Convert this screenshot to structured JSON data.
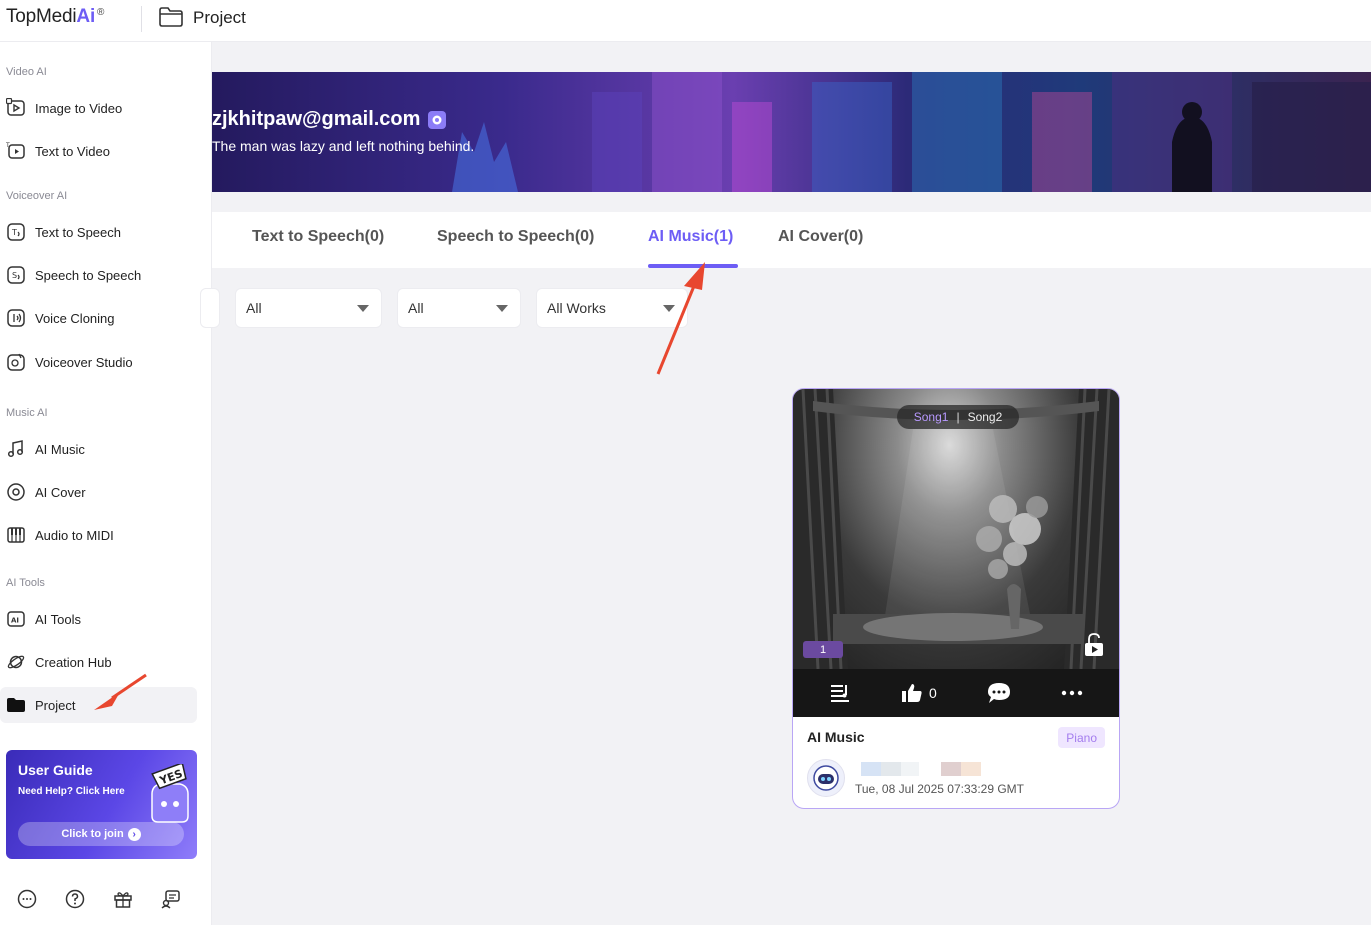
{
  "app": {
    "logo_text": "TopMedi",
    "logo_ai": "Ai",
    "logo_reg": "®",
    "page_title": "Project"
  },
  "sidebar": {
    "sections": [
      {
        "title": "Video AI",
        "items": [
          {
            "label": "Image to Video",
            "icon": "image-to-video-icon"
          },
          {
            "label": "Text to Video",
            "icon": "text-to-video-icon"
          }
        ]
      },
      {
        "title": "Voiceover AI",
        "items": [
          {
            "label": "Text to Speech",
            "icon": "text-to-speech-icon"
          },
          {
            "label": "Speech to Speech",
            "icon": "speech-to-speech-icon"
          },
          {
            "label": "Voice Cloning",
            "icon": "voice-cloning-icon"
          },
          {
            "label": "Voiceover Studio",
            "icon": "voiceover-studio-icon"
          }
        ]
      },
      {
        "title": "Music AI",
        "items": [
          {
            "label": "AI Music",
            "icon": "music-note-icon"
          },
          {
            "label": "AI Cover",
            "icon": "disc-icon"
          },
          {
            "label": "Audio to MIDI",
            "icon": "piano-icon"
          }
        ]
      },
      {
        "title": "AI Tools",
        "items": [
          {
            "label": "AI Tools",
            "icon": "ai-tools-icon"
          },
          {
            "label": "Creation Hub",
            "icon": "planet-icon"
          },
          {
            "label": "Project",
            "icon": "folder-icon",
            "active": true
          }
        ]
      }
    ],
    "guide": {
      "title": "User Guide",
      "subtitle": "Need Help? Click Here",
      "button": "Click to join",
      "mascot_text": "YES"
    },
    "bottom_icons": [
      "chat-icon",
      "help-icon",
      "gift-icon",
      "feedback-icon"
    ]
  },
  "profile": {
    "email": "zjkhitpaw@gmail.com",
    "bio": "The man was lazy and left nothing behind."
  },
  "tabs": [
    {
      "label": "Text to Speech(0)",
      "active": false
    },
    {
      "label": "Speech to Speech(0)",
      "active": false
    },
    {
      "label": "AI Music(1)",
      "active": true
    },
    {
      "label": "AI Cover(0)",
      "active": false
    }
  ],
  "filters": [
    {
      "value": "All"
    },
    {
      "value": "All"
    },
    {
      "value": "All Works"
    }
  ],
  "card": {
    "song_tabs": [
      "Song1",
      "Song2"
    ],
    "index_badge": "1",
    "likes": "0",
    "title": "AI Music",
    "genre": "Piano",
    "date": "Tue, 08 Jul 2025 07:33:29 GMT"
  },
  "colors": {
    "accent": "#6d5df5",
    "annotation_arrow": "#e8472f",
    "card_border": "#b9a6f5",
    "genre_tag_bg": "#efe6ff"
  }
}
